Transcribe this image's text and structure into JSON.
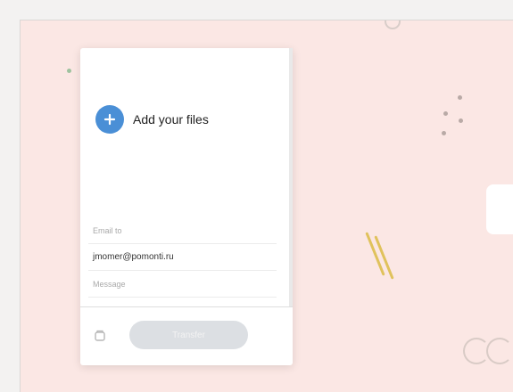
{
  "upload": {
    "add_files_label": "Add your files"
  },
  "form": {
    "email_to_placeholder": "Email to",
    "email_from_value": "jmomer@pomonti.ru",
    "message_placeholder": "Message"
  },
  "actions": {
    "transfer_label": "Transfer"
  },
  "icons": {
    "add": "plus-icon",
    "options": "settings-icon"
  },
  "colors": {
    "background": "#fbe7e4",
    "accent": "#4a8fd6",
    "button_disabled": "#dcdfe3"
  }
}
